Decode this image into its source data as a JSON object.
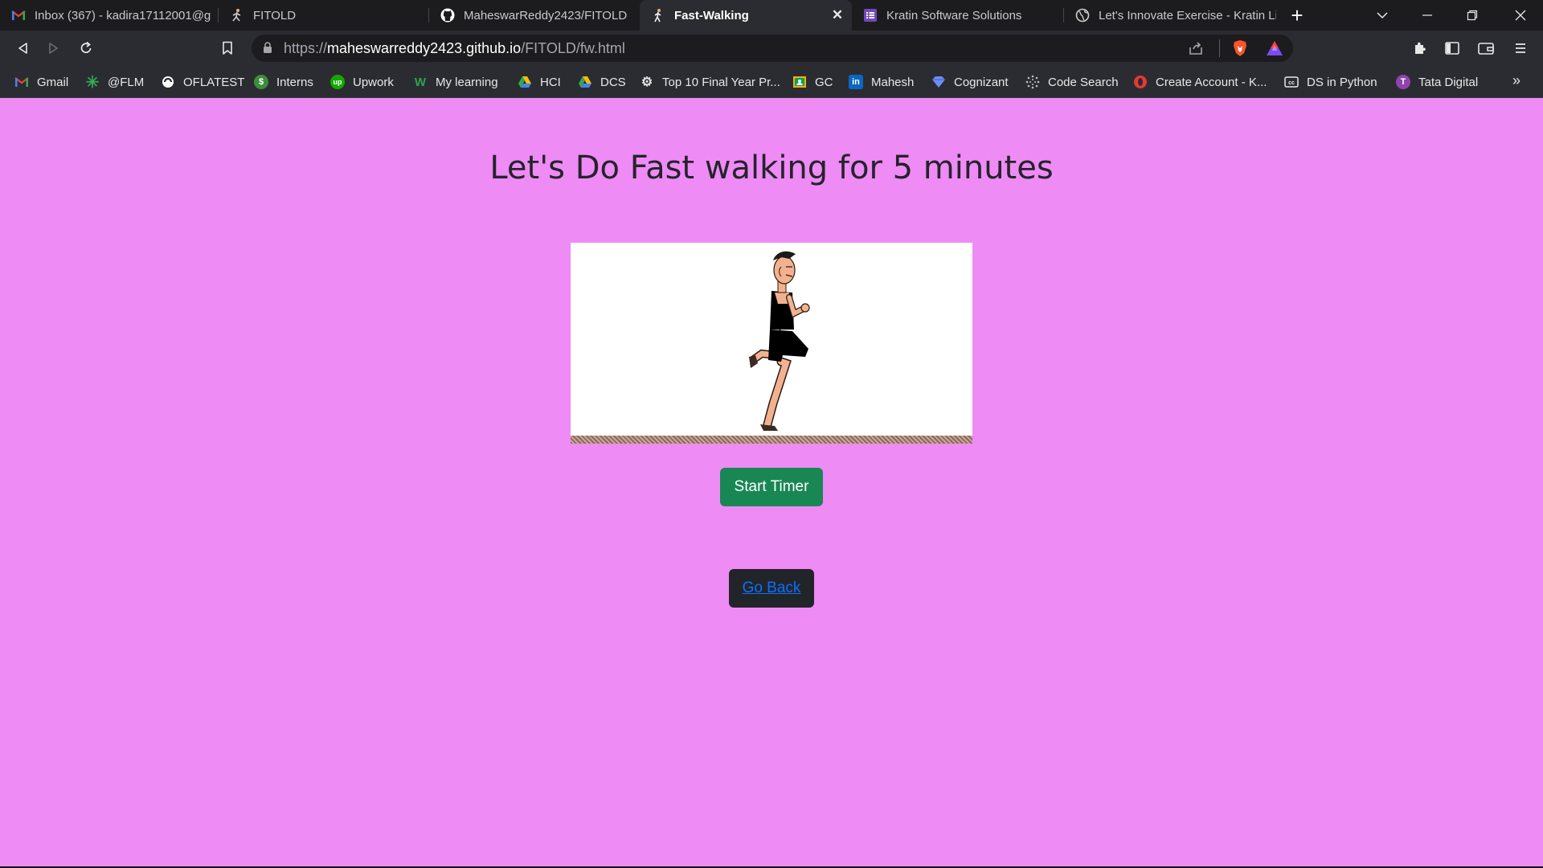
{
  "tabs": [
    {
      "label": "Inbox (367) - kadira17112001@g",
      "icon": "gmail-icon"
    },
    {
      "label": "FITOLD",
      "icon": "runner-icon"
    },
    {
      "label": "MaheswarReddy2423/FITOLD",
      "icon": "github-icon"
    },
    {
      "label": "Fast-Walking",
      "icon": "runner-icon",
      "active": true
    },
    {
      "label": "Kratin Software Solutions",
      "icon": "form-icon"
    },
    {
      "label": "Let's Innovate Exercise - Kratin Li",
      "icon": "globe-icon"
    }
  ],
  "url": {
    "scheme": "https://",
    "host": "maheswarreddy2423.github.io",
    "path": "/FITOLD/fw.html"
  },
  "bookmarks": [
    {
      "label": "Gmail",
      "icon": "gmail-icon",
      "color": "#ea4335"
    },
    {
      "label": "@FLM",
      "icon": "asterisk-icon",
      "color": "#34a853"
    },
    {
      "label": "OFLATEST",
      "icon": "swirl-icon",
      "color": "#ffffff"
    },
    {
      "label": "Interns",
      "icon": "dollar-icon",
      "color": "#3c8d3c"
    },
    {
      "label": "Upwork",
      "icon": "upwork-icon",
      "color": "#14a800"
    },
    {
      "label": "My learning",
      "icon": "w-icon",
      "color": "#2da44e"
    },
    {
      "label": "HCI",
      "icon": "drive-icon",
      "color": "#fbbc04"
    },
    {
      "label": "DCS",
      "icon": "drive-icon",
      "color": "#fbbc04"
    },
    {
      "label": "Top 10 Final Year Pr...",
      "icon": "gear-icon",
      "color": "#e0e0e0"
    },
    {
      "label": "GC",
      "icon": "classroom-icon",
      "color": "#f4b400"
    },
    {
      "label": "Mahesh",
      "icon": "linkedin-icon",
      "color": "#0a66c2"
    },
    {
      "label": "Cognizant",
      "icon": "diamond-icon",
      "color": "#6c8ef5"
    },
    {
      "label": "Code Search",
      "icon": "dots-icon",
      "color": "#bdbdbd"
    },
    {
      "label": "Create Account - K...",
      "icon": "opera-icon",
      "color": "#e53935"
    },
    {
      "label": "DS  in Python",
      "icon": "cc-icon",
      "color": "#e8e8ea"
    },
    {
      "label": "Tata Digital",
      "icon": "tata-icon",
      "color": "#8e44ad"
    }
  ],
  "page": {
    "title": "Let's Do Fast walking for 5 minutes",
    "start_button": "Start Timer",
    "back_link": "Go Back"
  },
  "colors": {
    "page_bg": "#ee8bf5",
    "start_button": "#198754",
    "back_button": "#212529",
    "link": "#0d6efd"
  }
}
